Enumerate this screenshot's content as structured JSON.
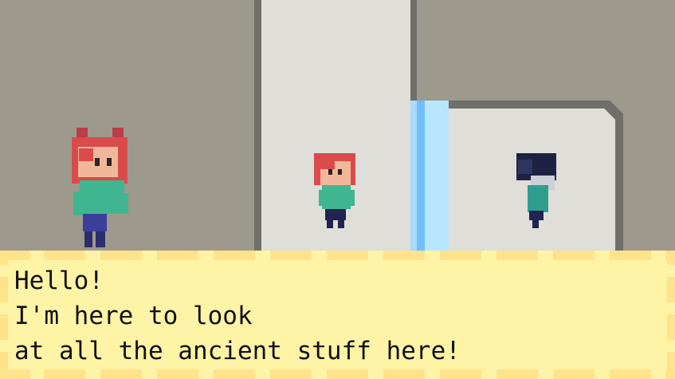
{
  "dialog": {
    "lines": [
      "Hello!",
      "I'm here to look",
      "at all the ancient stuff here!"
    ]
  },
  "colors": {
    "wall_dark": "#9d998c",
    "wall_light": "#dfded9",
    "wall_edge": "#6f6e69",
    "water_light": "#b8e6ff",
    "water_mid": "#6fbef8",
    "dialog_bg": "#fff3a6",
    "dialog_border": "#ffe38b",
    "text": "#111111"
  },
  "characters": [
    {
      "name": "girl-with-cat-ears",
      "hair": "#d94b4b",
      "shirt": "#3fb68f"
    },
    {
      "name": "child-red-hair",
      "hair": "#d94b4b",
      "shirt": "#3fb68f"
    },
    {
      "name": "dark-haired-child",
      "hair": "#1d2244",
      "shirt": "#2e9f8f"
    }
  ]
}
